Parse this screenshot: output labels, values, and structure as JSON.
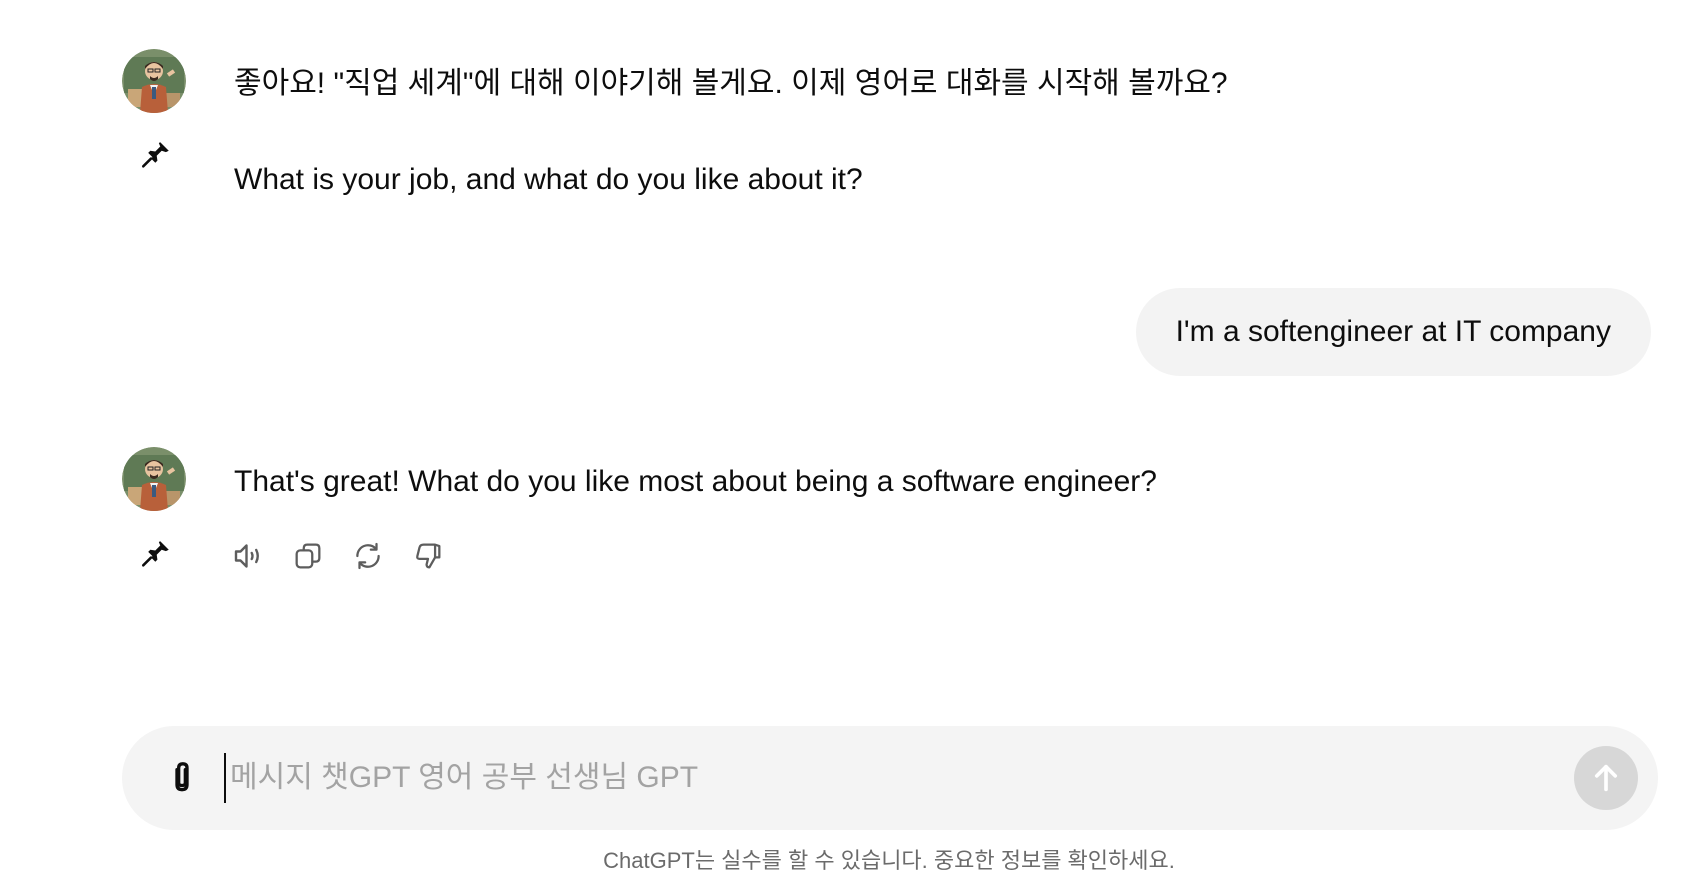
{
  "conversation": {
    "messages": [
      {
        "role": "assistant",
        "avatar_icon": "teacher-avatar-icon",
        "pin_icon": "pin-icon",
        "paragraphs": [
          "좋아요! \"직업 세계\"에 대해 이야기해 볼게요. 이제 영어로 대화를 시작해 볼까요?",
          "What is your job, and what do you like about it?"
        ]
      },
      {
        "role": "user",
        "text": "I'm a softengineer at IT company"
      },
      {
        "role": "assistant",
        "avatar_icon": "teacher-avatar-icon",
        "pin_icon": "pin-icon",
        "paragraphs": [
          "That's great! What do you like most about being a software engineer?"
        ],
        "actions": [
          "read-aloud-icon",
          "copy-icon",
          "regenerate-icon",
          "thumbs-down-icon"
        ]
      }
    ]
  },
  "composer": {
    "placeholder": "메시지 챗GPT 영어 공부 선생님 GPT",
    "value": "",
    "attach_icon": "paperclip-icon",
    "send_icon": "arrow-up-icon"
  },
  "footer": {
    "disclaimer": "ChatGPT는 실수를 할 수 있습니다. 중요한 정보를 확인하세요."
  },
  "colors": {
    "bubble_bg": "#f3f3f3",
    "composer_bg": "#f4f4f4",
    "send_bg": "#d7d7d7",
    "text": "#0d0d0d",
    "muted": "#6b6b6b"
  }
}
